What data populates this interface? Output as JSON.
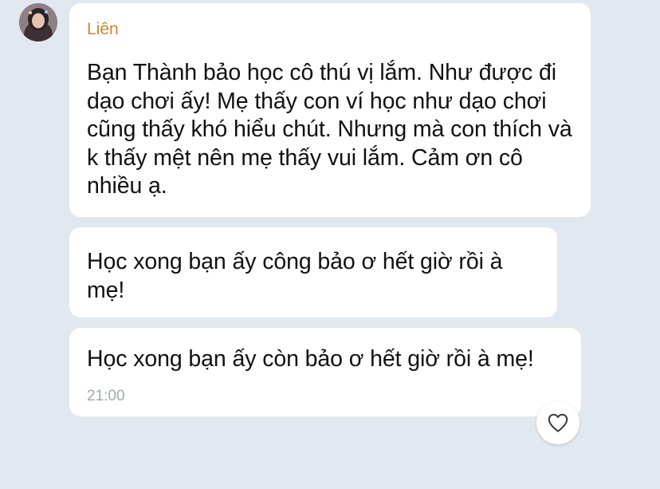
{
  "sender": {
    "name": "Liên",
    "name_color": "#d0862d"
  },
  "messages": [
    {
      "text": "Bạn Thành bảo học cô thú vị lắm. Như được đi dạo chơi ấy! Mẹ thấy con ví học như dạo chơi cũng thấy khó hiểu chút. Nhưng mà con thích và k thấy mệt nên mẹ thấy vui lắm. Cảm ơn cô nhiều ạ."
    },
    {
      "text": "Học xong bạn ấy công bảo ơ hết giờ rồi à mẹ!"
    },
    {
      "text": "Học xong bạn ấy còn bảo ơ hết giờ rồi à mẹ!",
      "time": "21:00"
    }
  ],
  "reaction_icon": "heart-outline-icon",
  "colors": {
    "background": "#e2e8f0",
    "bubble": "#ffffff",
    "timestamp": "#a3a8ae"
  }
}
